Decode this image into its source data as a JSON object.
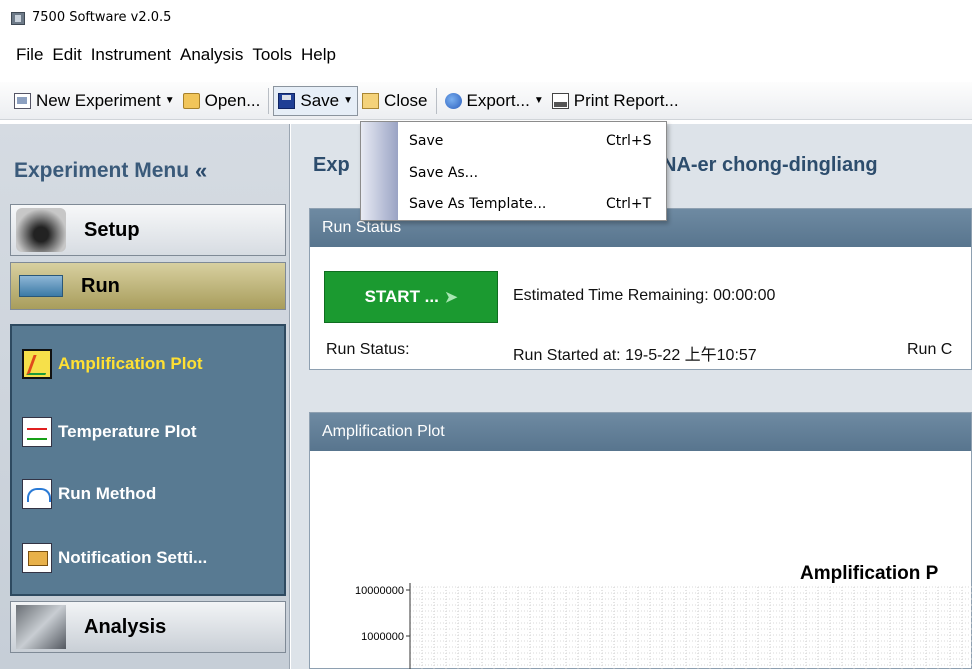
{
  "window": {
    "title": "7500 Software v2.0.5"
  },
  "menubar": [
    "File",
    "Edit",
    "Instrument",
    "Analysis",
    "Tools",
    "Help"
  ],
  "toolbar": {
    "new_experiment": "New Experiment",
    "open": "Open...",
    "save": "Save",
    "close": "Close",
    "export": "Export...",
    "print_report": "Print Report..."
  },
  "save_menu": {
    "items": [
      {
        "label": "Save",
        "shortcut": "Ctrl+S"
      },
      {
        "label": "Save As...",
        "shortcut": ""
      },
      {
        "label": "Save As Template...",
        "shortcut": "Ctrl+T"
      }
    ]
  },
  "sidebar": {
    "header": "Experiment Menu",
    "collapse_glyph": "«",
    "setup": "Setup",
    "run": "Run",
    "analysis": "Analysis",
    "run_items": [
      {
        "label": "Amplification Plot",
        "icon": "amplification-plot-icon",
        "active": true
      },
      {
        "label": "Temperature Plot",
        "icon": "temperature-plot-icon",
        "active": false
      },
      {
        "label": "Run Method",
        "icon": "run-method-icon",
        "active": false
      },
      {
        "label": "Notification Setti...",
        "icon": "notification-settings-icon",
        "active": false
      }
    ]
  },
  "main": {
    "experiment_title_prefix": "Exp",
    "experiment_title_suffix": "NA-er chong-dingliang",
    "run_status_panel": {
      "header": "Run Status",
      "start_button": "START ...",
      "estimated_time": "Estimated Time Remaining: 00:00:00",
      "run_status_label": "Run Status:",
      "run_started": "Run Started at: 19-5-22 上午10:57",
      "run_c_truncated": "Run C"
    },
    "amplification_panel": {
      "header": "Amplification Plot",
      "chart_title": "Amplification P"
    }
  },
  "chart_data": {
    "type": "line",
    "title": "Amplification P",
    "y_tick_labels": [
      "10000000",
      "1000000"
    ],
    "yscale": "log",
    "grid": true,
    "series": []
  },
  "colors": {
    "start_button": "#1b9a30",
    "panel_header": "#6e8aa2",
    "run_panel": "#587a92",
    "active_item": "#ffe033"
  }
}
